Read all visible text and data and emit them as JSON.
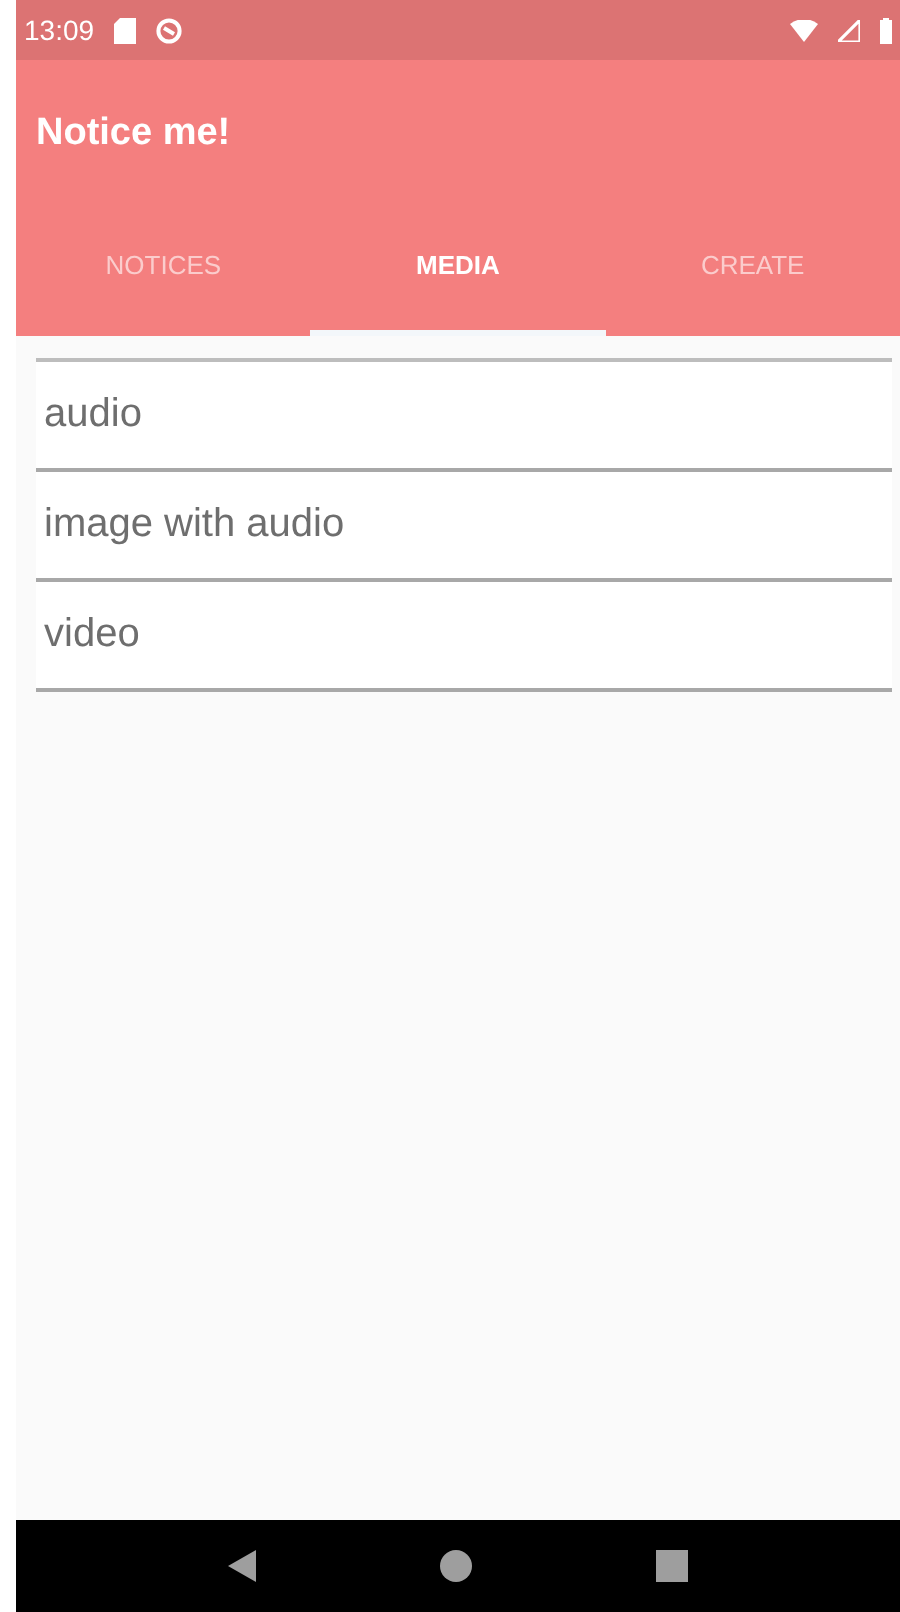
{
  "status_bar": {
    "time": "13:09"
  },
  "app_bar": {
    "title": "Notice me!"
  },
  "tabs": [
    {
      "label": "NOTICES",
      "selected": false
    },
    {
      "label": "MEDIA",
      "selected": true
    },
    {
      "label": "CREATE",
      "selected": false
    }
  ],
  "media_list": [
    {
      "label": "audio"
    },
    {
      "label": "image with audio"
    },
    {
      "label": "video"
    }
  ]
}
